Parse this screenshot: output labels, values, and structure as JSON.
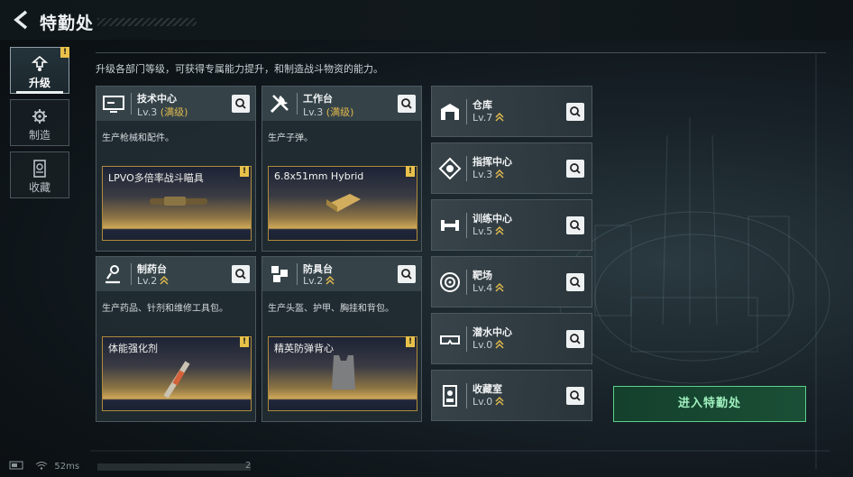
{
  "header": {
    "title": "特勤处",
    "back_icon": "back-arrow-icon"
  },
  "sidebar": {
    "items": [
      {
        "label": "升级",
        "icon": "upgrade-icon",
        "active": true,
        "alert": "!"
      },
      {
        "label": "制造",
        "icon": "gear-icon",
        "active": false
      },
      {
        "label": "收藏",
        "icon": "collection-icon",
        "active": false
      }
    ]
  },
  "description": "升级各部门等级，可获得专属能力提升，和制造战斗物资的能力。",
  "departments": [
    {
      "name": "技术中心",
      "level": "Lv.3",
      "max": "(满级)",
      "icon": "monitor-icon",
      "desc": "生产枪械和配件。",
      "product": "LPVO多倍率战斗瞄具",
      "alert": "!"
    },
    {
      "name": "工作台",
      "level": "Lv.3",
      "max": "(满级)",
      "icon": "tools-icon",
      "desc": "生产子弹。",
      "product": "6.8x51mm Hybrid",
      "alert": "!"
    },
    {
      "name": "制药台",
      "level": "Lv.2",
      "max": "",
      "icon": "microscope-icon",
      "desc": "生产药品、针剂和维修工具包。",
      "product": "体能强化剂",
      "alert": "!"
    },
    {
      "name": "防具台",
      "level": "Lv.2",
      "max": "",
      "icon": "armor-icon",
      "desc": "生产头盔、护甲、胸挂和背包。",
      "product": "精英防弹背心",
      "alert": "!"
    }
  ],
  "facilities": [
    {
      "name": "仓库",
      "level": "Lv.7",
      "icon": "warehouse-icon"
    },
    {
      "name": "指挥中心",
      "level": "Lv.3",
      "icon": "command-icon"
    },
    {
      "name": "训练中心",
      "level": "Lv.5",
      "icon": "dumbbell-icon"
    },
    {
      "name": "靶场",
      "level": "Lv.4",
      "icon": "target-icon"
    },
    {
      "name": "潜水中心",
      "level": "Lv.0",
      "icon": "diving-mask-icon"
    },
    {
      "name": "收藏室",
      "level": "Lv.0",
      "icon": "collection-room-icon"
    }
  ],
  "enter_button": "进入特勤处",
  "status": {
    "ping": "52ms",
    "page": "2"
  },
  "colors": {
    "accent_gold": "#e0b84c",
    "enter_green": "#5bd28a",
    "alert_yellow": "#e8c14a"
  }
}
